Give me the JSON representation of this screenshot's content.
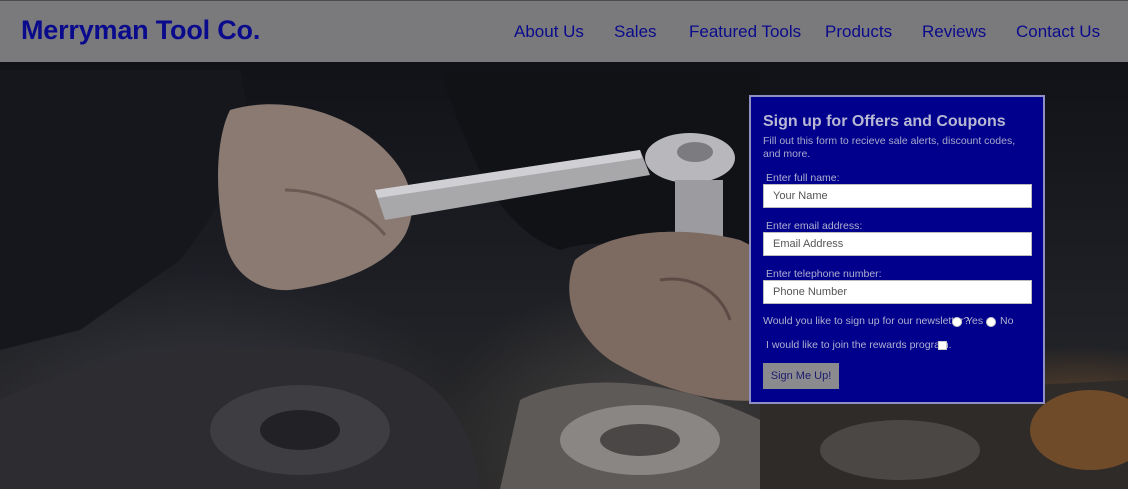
{
  "header": {
    "brand": "Merryman Tool Co.",
    "nav": [
      "About Us",
      "Sales",
      "Featured Tools",
      "Products",
      "Reviews",
      "Contact Us"
    ]
  },
  "signup": {
    "title": "Sign up for Offers and Coupons",
    "description": "Fill out this form to recieve sale alerts, discount codes, and more.",
    "name_label": "Enter full name:",
    "name_placeholder": "Your Name",
    "email_label": "Enter email address:",
    "email_placeholder": "Email Address",
    "phone_label": "Enter telephone number:",
    "phone_placeholder": "Phone Number",
    "newsletter_question": "Would you like to sign up for our newsletter?",
    "option_yes": "Yes",
    "option_no": "No",
    "rewards_label": "I would like to join the rewards program.",
    "submit_label": "Sign Me Up!"
  },
  "hero": {
    "image_subject": "mechanic hands using ratchet wrench on engine"
  },
  "colors": {
    "brand_blue": "#0a0a8c",
    "header_gray": "#7a7a7c",
    "form_bg": "#00008c"
  }
}
